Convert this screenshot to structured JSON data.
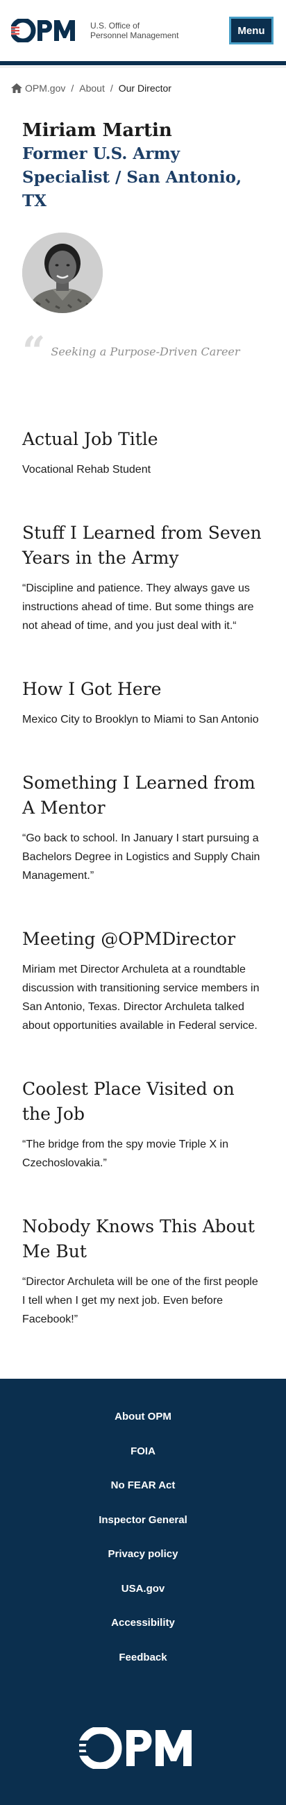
{
  "header": {
    "logo_wordmark": "OPM",
    "logo_line1": "U.S. Office of",
    "logo_line2": "Personnel Management",
    "menu_label": "Menu"
  },
  "breadcrumb": {
    "home": "OPM.gov",
    "about": "About",
    "current": "Our Director"
  },
  "profile": {
    "name": "Miriam Martin",
    "subtitle": "Former U.S. Army Specialist / San Antonio, TX",
    "quote": "Seeking a Purpose-Driven Career"
  },
  "sections": [
    {
      "heading": "Actual Job Title",
      "body": "Vocational Rehab Student"
    },
    {
      "heading": "Stuff I Learned from Seven Years in the Army",
      "body": "“Discipline and patience. They always gave us instructions ahead of time. But some things are not ahead of time, and you just deal with it.“"
    },
    {
      "heading": "How I Got Here",
      "body": "Mexico City to Brooklyn to Miami to San Antonio"
    },
    {
      "heading": "Something I Learned from A Mentor",
      "body": "“Go back to school. In January I start pursuing a Bachelors Degree in Logistics and Supply Chain Management.”"
    },
    {
      "heading": "Meeting @OPMDirector",
      "body": "Miriam met Director Archuleta at a roundtable discussion with transitioning service members in San Antonio, Texas. Director Archuleta talked about opportunities available in Federal service."
    },
    {
      "heading": "Coolest Place Visited on the Job",
      "body": "“The bridge from the spy movie Triple X in Czechoslovakia.”"
    },
    {
      "heading": "Nobody Knows This About Me But",
      "body": "“Director Archuleta will be one of the first people I tell when I get my next job. Even before Facebook!”"
    }
  ],
  "footer": {
    "links": [
      "About OPM",
      "FOIA",
      "No FEAR Act",
      "Inspector General",
      "Privacy policy",
      "USA.gov",
      "Accessibility",
      "Feedback"
    ],
    "logo_wordmark": "OPM"
  },
  "colors": {
    "navy": "#0b2f4e",
    "accent_blue": "#1c3e66",
    "logo_red": "#d63d3a",
    "menu_border": "#49a0c8"
  }
}
